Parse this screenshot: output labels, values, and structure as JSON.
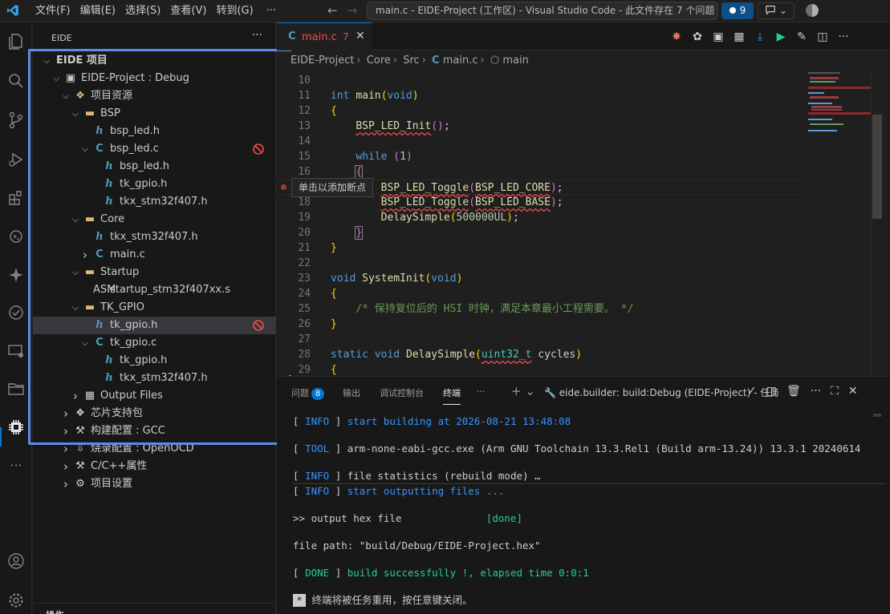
{
  "titlebar": {
    "menu": [
      "文件(F)",
      "编辑(E)",
      "选择(S)",
      "查看(V)",
      "转到(G)"
    ],
    "more": "···",
    "command_center": "main.c - EIDE-Project (工作区) - Visual Studio Code - 此文件存在 7 个问题 [管...",
    "problems_count": "9"
  },
  "sidebar": {
    "title": "EIDE",
    "more": "···",
    "tree": [
      {
        "label": "EIDE 项目",
        "indent": 0,
        "chev": "down",
        "bold": true
      },
      {
        "label": "EIDE-Project : Debug",
        "indent": 1,
        "chev": "down",
        "icon": "chip"
      },
      {
        "label": "项目资源",
        "indent": 2,
        "chev": "down",
        "icon": "resources"
      },
      {
        "label": "BSP",
        "indent": 3,
        "chev": "down",
        "icon": "folder"
      },
      {
        "label": "bsp_led.h",
        "indent": 4,
        "icon": "h"
      },
      {
        "label": "bsp_led.c",
        "indent": 4,
        "chev": "down",
        "icon": "c",
        "error": true
      },
      {
        "label": "bsp_led.h",
        "indent": 5,
        "icon": "h"
      },
      {
        "label": "tk_gpio.h",
        "indent": 5,
        "icon": "h"
      },
      {
        "label": "tkx_stm32f407.h",
        "indent": 5,
        "icon": "h"
      },
      {
        "label": "Core",
        "indent": 3,
        "chev": "down",
        "icon": "folder"
      },
      {
        "label": "tkx_stm32f407.h",
        "indent": 4,
        "icon": "h"
      },
      {
        "label": "main.c",
        "indent": 4,
        "chev": "right",
        "icon": "c"
      },
      {
        "label": "Startup",
        "indent": 3,
        "chev": "down",
        "icon": "folder"
      },
      {
        "label": "startup_stm32f407xx.s",
        "indent": 4,
        "icon": "asm"
      },
      {
        "label": "TK_GPIO",
        "indent": 3,
        "chev": "down",
        "icon": "folder"
      },
      {
        "label": "tk_gpio.h",
        "indent": 4,
        "icon": "h",
        "selected": true,
        "error": true
      },
      {
        "label": "tk_gpio.c",
        "indent": 4,
        "chev": "down",
        "icon": "c"
      },
      {
        "label": "tk_gpio.h",
        "indent": 5,
        "icon": "h"
      },
      {
        "label": "tkx_stm32f407.h",
        "indent": 5,
        "icon": "h"
      },
      {
        "label": "Output Files",
        "indent": 3,
        "chev": "right",
        "icon": "output"
      },
      {
        "label": "芯片支持包",
        "indent": 2,
        "chev": "right",
        "icon": "package"
      },
      {
        "label": "构建配置 : GCC",
        "indent": 2,
        "chev": "right",
        "icon": "hammer"
      },
      {
        "label": "烧录配置 : OpenOCD",
        "indent": 2,
        "chev": "right",
        "icon": "flash"
      },
      {
        "label": "C/C++属性",
        "indent": 2,
        "chev": "right",
        "icon": "wrench"
      },
      {
        "label": "项目设置",
        "indent": 2,
        "chev": "right",
        "icon": "gear"
      }
    ],
    "bottom_section": "操作"
  },
  "editor": {
    "tab": {
      "name": "main.c",
      "problems": "7"
    },
    "breadcrumb": [
      "EIDE-Project",
      "Core",
      "Src",
      "main.c",
      "main"
    ],
    "tooltip": "单击以添加断点"
  },
  "panel": {
    "tabs": [
      "问题",
      "输出",
      "调试控制台",
      "终端",
      "···"
    ],
    "problems_badge": "8",
    "active_tab": "终端",
    "task_name": "eide.builder: build:Debug (EIDE-Project) - 任务",
    "terminal_lines": [
      {
        "tag": "INFO",
        "text": "start building at 2026-08-21 13:48:08"
      },
      {
        "tag": "TOOL",
        "text": "arm-none-eabi-gcc.exe (Arm GNU Toolchain 13.3.Rel1 (Build arm-13.24)) 13.3.1 20240614"
      },
      {
        "tag": "INFO",
        "text": "file statistics (rebuild mode) …"
      },
      {
        "tag": "INFO",
        "text": "start outputting files ..."
      },
      {
        "plain": ">> output hex file",
        "done": "[done]"
      },
      {
        "plain": "file path: \"build/Debug/EIDE-Project.hex\""
      },
      {
        "tag": "DONE",
        "text": "build successfully !, elapsed time 0:0:1"
      },
      {
        "cursor": "*",
        "text": "终端将被任务重用，按任意键关闭。"
      }
    ]
  },
  "colors": {
    "accent": "#0078d4",
    "highlight_box": "#5b8de8",
    "error": "#f14c4c"
  }
}
